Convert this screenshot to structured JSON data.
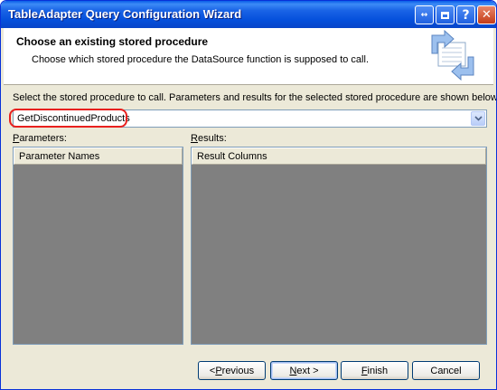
{
  "window": {
    "title": "TableAdapter Query Configuration Wizard",
    "controls": {
      "back_forward": "↔",
      "help": "?",
      "close": "✕"
    }
  },
  "header": {
    "title": "Choose an existing stored procedure",
    "subtitle": "Choose which stored procedure the DataSource function is supposed to call.",
    "icon": "wizard-arrows-icon"
  },
  "instructions": "Select the stored procedure to call. Parameters and results for the selected stored procedure are shown below.",
  "stored_procedure_combo": {
    "value": "GetDiscontinuedProducts",
    "highlighted": true,
    "highlight_color": "#e8201e"
  },
  "parameters": {
    "label_accel": "P",
    "label_rest": "arameters:",
    "column_header": "Parameter Names"
  },
  "results": {
    "label_accel": "R",
    "label_rest": "esults:",
    "column_header": "Result Columns"
  },
  "buttons": {
    "previous": {
      "prefix": "< ",
      "accel": "P",
      "rest": "revious",
      "enabled": true
    },
    "next": {
      "accel": "N",
      "rest": "ext >",
      "default": true
    },
    "finish": {
      "accel": "F",
      "rest": "inish"
    },
    "cancel": {
      "label": "Cancel"
    }
  },
  "colors": {
    "title_bar": "#0550dc",
    "dialog_bg": "#ece9d8",
    "grid_bg": "#808080"
  }
}
